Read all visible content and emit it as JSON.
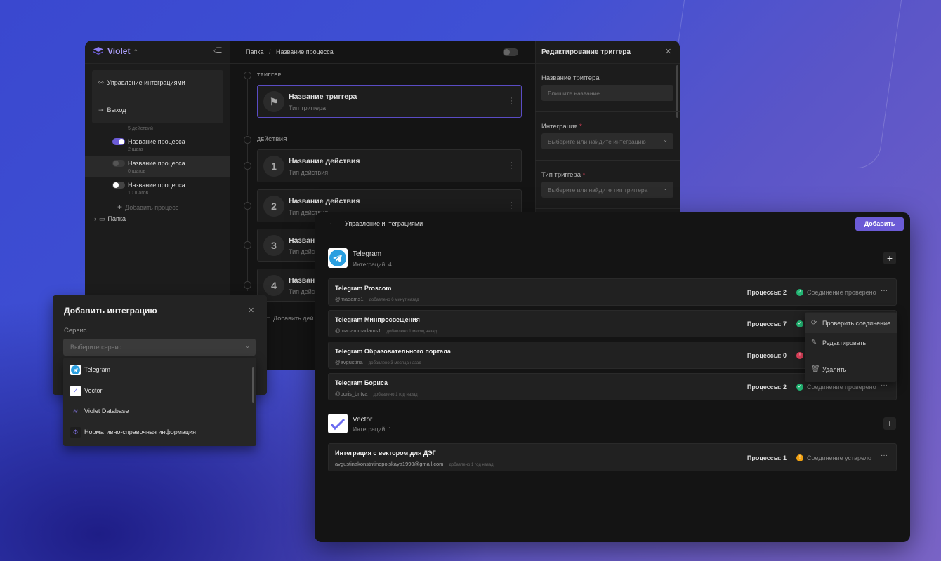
{
  "app": {
    "name": "Violet"
  },
  "sidebar": {
    "popup": [
      {
        "label": "Управление интеграциями",
        "icon": "integrations-icon"
      },
      {
        "label": "Выход",
        "icon": "logout-icon"
      }
    ],
    "prev_meta": "5 действий",
    "processes": [
      {
        "name": "Название процесса",
        "meta": "2 шага",
        "enabled": true
      },
      {
        "name": "Название процесса",
        "meta": "0 шагов",
        "enabled": false,
        "selected": true
      },
      {
        "name": "Название процесса",
        "meta": "10 шагов",
        "enabled": false
      }
    ],
    "add_process": "Добавить процесс",
    "folder": "Папка"
  },
  "editor": {
    "breadcrumb": [
      "Папка",
      "/",
      "Название процесса"
    ],
    "trigger_section": "ТРИГГЕР",
    "trigger": {
      "title": "Название триггера",
      "subtitle": "Тип триггера"
    },
    "actions_section": "ДЕЙСТВИЯ",
    "actions": [
      {
        "num": "1",
        "title": "Название действия",
        "subtitle": "Тип действия"
      },
      {
        "num": "2",
        "title": "Название действия",
        "subtitle": "Тип действия"
      },
      {
        "num": "3",
        "title": "Названи",
        "subtitle": "Тип дейст"
      },
      {
        "num": "4",
        "title": "Названи",
        "subtitle": "Тип дейст"
      }
    ],
    "add_action": "Добавить дей"
  },
  "trigger_panel": {
    "title": "Редактирование триггера",
    "name_label": "Название триггера",
    "name_placeholder": "Впишите название",
    "integration_label": "Интеграция",
    "integration_placeholder": "Выберите или найдите интеграцию",
    "type_label": "Тип триггера",
    "type_placeholder": "Выберите или найдите тип триггера",
    "required_mark": "*"
  },
  "integrations": {
    "title": "Управление интеграциями",
    "add_button": "Добавить",
    "services": [
      {
        "name": "Telegram",
        "count": "Интеграций: 4",
        "rows": [
          {
            "title": "Telegram Proscom",
            "user": "@madams1",
            "added": "добавлено 6 минут назад",
            "processes": "Процессы: 2",
            "status": "ok",
            "status_text": "Соединение проверено"
          },
          {
            "title": "Telegram Минпросвещения",
            "user": "@madammadams1",
            "added": "добавлено 1 месяц назад",
            "processes": "Процессы: 7",
            "status": "ok",
            "status_text": ""
          },
          {
            "title": "Telegram Образовательного портала",
            "user": "@avgustina",
            "added": "добавлено 3 месяца назад",
            "processes": "Процессы: 0",
            "status": "error",
            "status_text": ""
          },
          {
            "title": "Telegram Бориса",
            "user": "@boris_britva",
            "added": "добавлено 1 год назад",
            "processes": "Процессы: 2",
            "status": "ok",
            "status_text": "Соединение проверено"
          }
        ]
      },
      {
        "name": "Vector",
        "count": "Интеграций: 1",
        "rows": [
          {
            "title": "Интеграция с вектором для ДЭГ",
            "user": "avgustinakonstntinopolskaya1990@gmail.com",
            "added": "добавлено 1 год назад",
            "processes": "Процессы: 1",
            "status": "warning",
            "status_text": "Соединение устарело"
          }
        ]
      }
    ],
    "context_menu": [
      "Проверить соединение",
      "Редактировать",
      "Удалить"
    ],
    "colors": {
      "ok": "#22b573",
      "error": "#e0405a",
      "warning": "#f0a010",
      "accent": "#6b5bd6"
    }
  },
  "add_dialog": {
    "title": "Добавить интеграцию",
    "service_label": "Сервис",
    "service_placeholder": "Выберите сервис",
    "options": [
      "Telegram",
      "Vector",
      "Violet Database",
      "Нормативно-справочная информация"
    ]
  }
}
